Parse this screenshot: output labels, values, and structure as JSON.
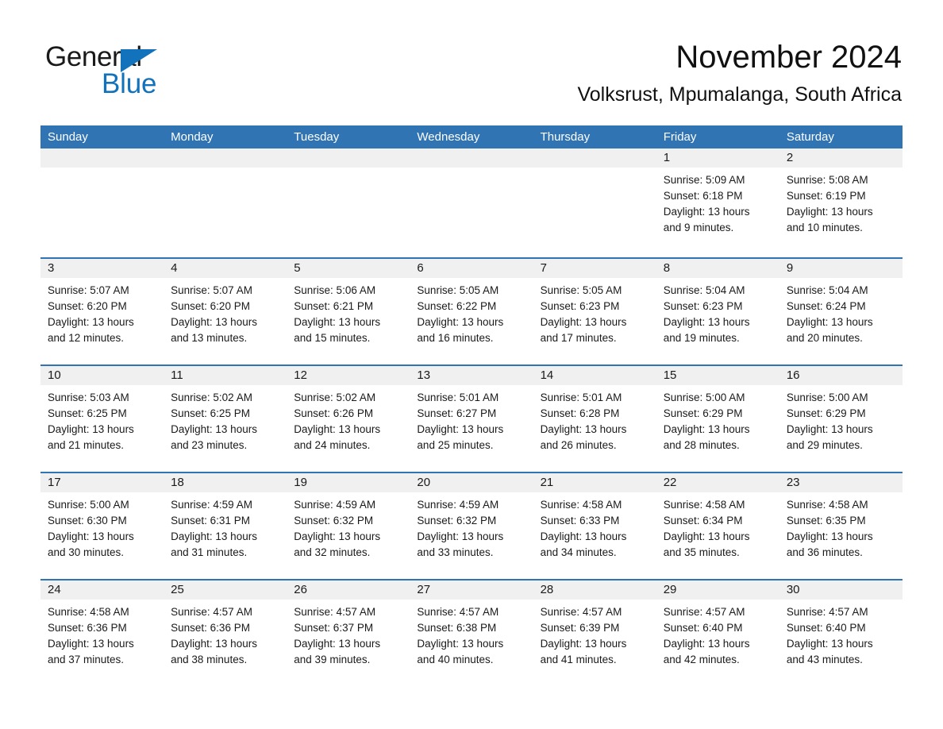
{
  "logo": {
    "text_general": "General",
    "text_blue": "Blue",
    "color_blue": "#1272bb",
    "color_dark": "#1a1a1a"
  },
  "header": {
    "title": "November 2024",
    "subtitle": "Volksrust, Mpumalanga, South Africa"
  },
  "theme": {
    "header_blue": "#3174b4",
    "day_band_gray": "#f0f0f0",
    "text_dark": "#1a1a1a"
  },
  "weekdays": [
    "Sunday",
    "Monday",
    "Tuesday",
    "Wednesday",
    "Thursday",
    "Friday",
    "Saturday"
  ],
  "weeks": [
    [
      {
        "day": "",
        "empty": true
      },
      {
        "day": "",
        "empty": true
      },
      {
        "day": "",
        "empty": true
      },
      {
        "day": "",
        "empty": true
      },
      {
        "day": "",
        "empty": true
      },
      {
        "day": "1",
        "sunrise": "Sunrise: 5:09 AM",
        "sunset": "Sunset: 6:18 PM",
        "daylight_1": "Daylight: 13 hours",
        "daylight_2": "and 9 minutes."
      },
      {
        "day": "2",
        "sunrise": "Sunrise: 5:08 AM",
        "sunset": "Sunset: 6:19 PM",
        "daylight_1": "Daylight: 13 hours",
        "daylight_2": "and 10 minutes."
      }
    ],
    [
      {
        "day": "3",
        "sunrise": "Sunrise: 5:07 AM",
        "sunset": "Sunset: 6:20 PM",
        "daylight_1": "Daylight: 13 hours",
        "daylight_2": "and 12 minutes."
      },
      {
        "day": "4",
        "sunrise": "Sunrise: 5:07 AM",
        "sunset": "Sunset: 6:20 PM",
        "daylight_1": "Daylight: 13 hours",
        "daylight_2": "and 13 minutes."
      },
      {
        "day": "5",
        "sunrise": "Sunrise: 5:06 AM",
        "sunset": "Sunset: 6:21 PM",
        "daylight_1": "Daylight: 13 hours",
        "daylight_2": "and 15 minutes."
      },
      {
        "day": "6",
        "sunrise": "Sunrise: 5:05 AM",
        "sunset": "Sunset: 6:22 PM",
        "daylight_1": "Daylight: 13 hours",
        "daylight_2": "and 16 minutes."
      },
      {
        "day": "7",
        "sunrise": "Sunrise: 5:05 AM",
        "sunset": "Sunset: 6:23 PM",
        "daylight_1": "Daylight: 13 hours",
        "daylight_2": "and 17 minutes."
      },
      {
        "day": "8",
        "sunrise": "Sunrise: 5:04 AM",
        "sunset": "Sunset: 6:23 PM",
        "daylight_1": "Daylight: 13 hours",
        "daylight_2": "and 19 minutes."
      },
      {
        "day": "9",
        "sunrise": "Sunrise: 5:04 AM",
        "sunset": "Sunset: 6:24 PM",
        "daylight_1": "Daylight: 13 hours",
        "daylight_2": "and 20 minutes."
      }
    ],
    [
      {
        "day": "10",
        "sunrise": "Sunrise: 5:03 AM",
        "sunset": "Sunset: 6:25 PM",
        "daylight_1": "Daylight: 13 hours",
        "daylight_2": "and 21 minutes."
      },
      {
        "day": "11",
        "sunrise": "Sunrise: 5:02 AM",
        "sunset": "Sunset: 6:25 PM",
        "daylight_1": "Daylight: 13 hours",
        "daylight_2": "and 23 minutes."
      },
      {
        "day": "12",
        "sunrise": "Sunrise: 5:02 AM",
        "sunset": "Sunset: 6:26 PM",
        "daylight_1": "Daylight: 13 hours",
        "daylight_2": "and 24 minutes."
      },
      {
        "day": "13",
        "sunrise": "Sunrise: 5:01 AM",
        "sunset": "Sunset: 6:27 PM",
        "daylight_1": "Daylight: 13 hours",
        "daylight_2": "and 25 minutes."
      },
      {
        "day": "14",
        "sunrise": "Sunrise: 5:01 AM",
        "sunset": "Sunset: 6:28 PM",
        "daylight_1": "Daylight: 13 hours",
        "daylight_2": "and 26 minutes."
      },
      {
        "day": "15",
        "sunrise": "Sunrise: 5:00 AM",
        "sunset": "Sunset: 6:29 PM",
        "daylight_1": "Daylight: 13 hours",
        "daylight_2": "and 28 minutes."
      },
      {
        "day": "16",
        "sunrise": "Sunrise: 5:00 AM",
        "sunset": "Sunset: 6:29 PM",
        "daylight_1": "Daylight: 13 hours",
        "daylight_2": "and 29 minutes."
      }
    ],
    [
      {
        "day": "17",
        "sunrise": "Sunrise: 5:00 AM",
        "sunset": "Sunset: 6:30 PM",
        "daylight_1": "Daylight: 13 hours",
        "daylight_2": "and 30 minutes."
      },
      {
        "day": "18",
        "sunrise": "Sunrise: 4:59 AM",
        "sunset": "Sunset: 6:31 PM",
        "daylight_1": "Daylight: 13 hours",
        "daylight_2": "and 31 minutes."
      },
      {
        "day": "19",
        "sunrise": "Sunrise: 4:59 AM",
        "sunset": "Sunset: 6:32 PM",
        "daylight_1": "Daylight: 13 hours",
        "daylight_2": "and 32 minutes."
      },
      {
        "day": "20",
        "sunrise": "Sunrise: 4:59 AM",
        "sunset": "Sunset: 6:32 PM",
        "daylight_1": "Daylight: 13 hours",
        "daylight_2": "and 33 minutes."
      },
      {
        "day": "21",
        "sunrise": "Sunrise: 4:58 AM",
        "sunset": "Sunset: 6:33 PM",
        "daylight_1": "Daylight: 13 hours",
        "daylight_2": "and 34 minutes."
      },
      {
        "day": "22",
        "sunrise": "Sunrise: 4:58 AM",
        "sunset": "Sunset: 6:34 PM",
        "daylight_1": "Daylight: 13 hours",
        "daylight_2": "and 35 minutes."
      },
      {
        "day": "23",
        "sunrise": "Sunrise: 4:58 AM",
        "sunset": "Sunset: 6:35 PM",
        "daylight_1": "Daylight: 13 hours",
        "daylight_2": "and 36 minutes."
      }
    ],
    [
      {
        "day": "24",
        "sunrise": "Sunrise: 4:58 AM",
        "sunset": "Sunset: 6:36 PM",
        "daylight_1": "Daylight: 13 hours",
        "daylight_2": "and 37 minutes."
      },
      {
        "day": "25",
        "sunrise": "Sunrise: 4:57 AM",
        "sunset": "Sunset: 6:36 PM",
        "daylight_1": "Daylight: 13 hours",
        "daylight_2": "and 38 minutes."
      },
      {
        "day": "26",
        "sunrise": "Sunrise: 4:57 AM",
        "sunset": "Sunset: 6:37 PM",
        "daylight_1": "Daylight: 13 hours",
        "daylight_2": "and 39 minutes."
      },
      {
        "day": "27",
        "sunrise": "Sunrise: 4:57 AM",
        "sunset": "Sunset: 6:38 PM",
        "daylight_1": "Daylight: 13 hours",
        "daylight_2": "and 40 minutes."
      },
      {
        "day": "28",
        "sunrise": "Sunrise: 4:57 AM",
        "sunset": "Sunset: 6:39 PM",
        "daylight_1": "Daylight: 13 hours",
        "daylight_2": "and 41 minutes."
      },
      {
        "day": "29",
        "sunrise": "Sunrise: 4:57 AM",
        "sunset": "Sunset: 6:40 PM",
        "daylight_1": "Daylight: 13 hours",
        "daylight_2": "and 42 minutes."
      },
      {
        "day": "30",
        "sunrise": "Sunrise: 4:57 AM",
        "sunset": "Sunset: 6:40 PM",
        "daylight_1": "Daylight: 13 hours",
        "daylight_2": "and 43 minutes."
      }
    ]
  ]
}
